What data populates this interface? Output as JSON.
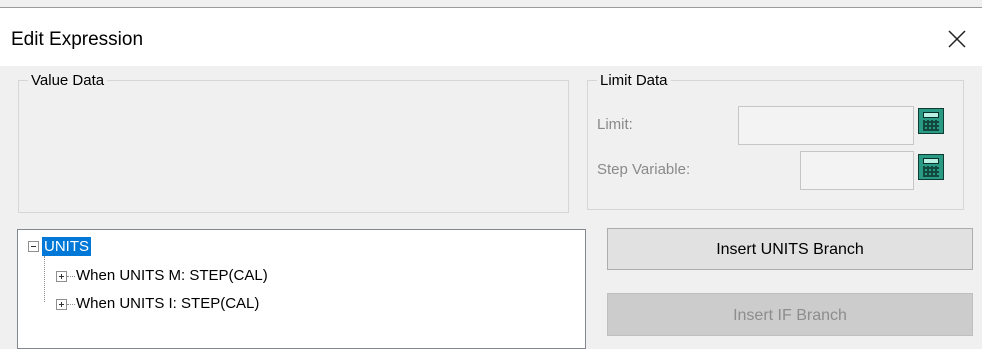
{
  "dialog": {
    "title": "Edit Expression",
    "close_icon": "close-icon"
  },
  "value_data": {
    "legend": "Value Data"
  },
  "limit_data": {
    "legend": "Limit Data",
    "limit_label": "Limit:",
    "limit_value": "",
    "step_label": "Step Variable:",
    "step_value": "",
    "calculator_icon": "calculator-icon"
  },
  "tree": {
    "root": {
      "label": "UNITS",
      "expanded": true,
      "selected": true
    },
    "children": [
      {
        "label": "When UNITS M: STEP(CAL)",
        "expanded": false
      },
      {
        "label": "When UNITS I: STEP(CAL)",
        "expanded": false
      }
    ]
  },
  "buttons": {
    "insert_units": "Insert UNITS Branch",
    "insert_if": "Insert IF Branch",
    "insert_if_disabled": true
  },
  "colors": {
    "selection": "#0078d7",
    "calculator": "#2a9a84",
    "disabled_text": "#8d8d8d"
  }
}
